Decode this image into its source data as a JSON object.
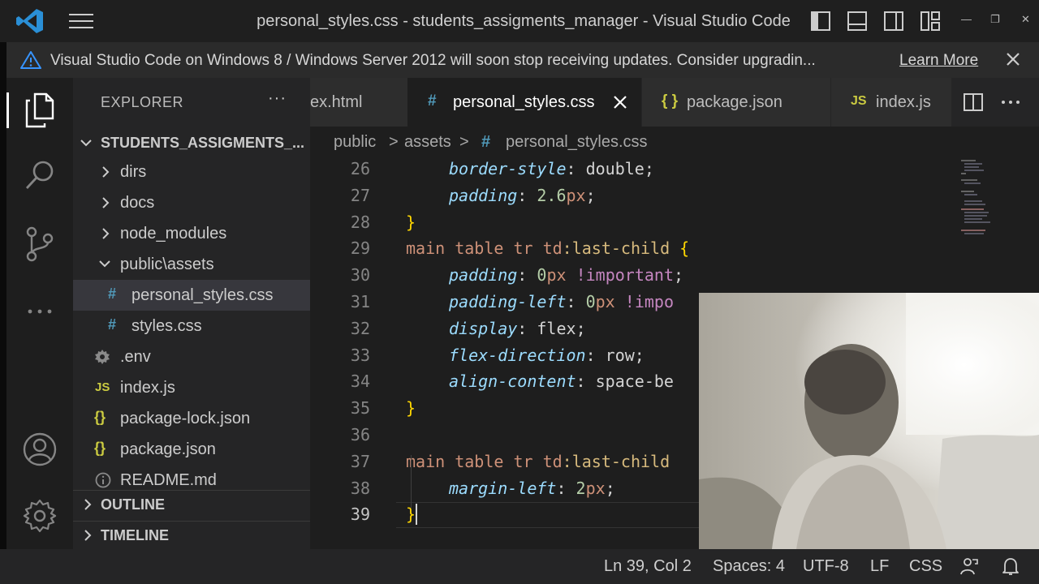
{
  "window": {
    "title": "personal_styles.css - students_assigments_manager - Visual Studio Code",
    "controls": [
      "—",
      "❐",
      "✕"
    ]
  },
  "banner": {
    "message": "Visual Studio Code on Windows 8 / Windows Server 2012 will soon stop receiving updates. Consider upgradin...",
    "learn_more": "Learn More"
  },
  "activity_bar": {
    "items": [
      "files-icon",
      "search-icon",
      "source-control-icon",
      "more-icon"
    ],
    "bottom": [
      "account-icon",
      "settings-icon"
    ]
  },
  "explorer": {
    "header": "EXPLORER",
    "more": "···",
    "project": "STUDENTS_ASSIGMENTS_...",
    "tree": [
      {
        "label": "dirs",
        "type": "folder"
      },
      {
        "label": "docs",
        "type": "folder"
      },
      {
        "label": "node_modules",
        "type": "folder"
      },
      {
        "label": "public\\assets",
        "type": "folder-open"
      },
      {
        "label": "personal_styles.css",
        "type": "css",
        "icon": "#"
      },
      {
        "label": "styles.css",
        "type": "css",
        "icon": "#"
      },
      {
        "label": ".env",
        "type": "env"
      },
      {
        "label": "index.js",
        "type": "js",
        "icon": "JS"
      },
      {
        "label": "package-lock.json",
        "type": "json",
        "icon": "{}"
      },
      {
        "label": "package.json",
        "type": "json",
        "icon": "{}"
      },
      {
        "label": "README.md",
        "type": "info"
      }
    ],
    "sections": [
      "OUTLINE",
      "TIMELINE"
    ]
  },
  "tabs": [
    {
      "label": "ex.html",
      "icon": ""
    },
    {
      "label": "personal_styles.css",
      "icon": "#"
    },
    {
      "label": "package.json",
      "icon": "{ }"
    },
    {
      "label": "index.js",
      "icon": "JS"
    }
  ],
  "breadcrumb": {
    "parts": [
      "public",
      "assets",
      "personal_styles.css"
    ],
    "sep": ">",
    "file_icon": "#"
  },
  "editor": {
    "lines": [
      {
        "n": "26",
        "prop": "border-style",
        "val": "double",
        "sep": ": ",
        "end": ";"
      },
      {
        "n": "27",
        "prop": "padding",
        "num": "2.6",
        "unit": "px",
        "sep": ": ",
        "end": ";"
      },
      {
        "n": "28",
        "brace": "}"
      },
      {
        "n": "29",
        "selector": "main table tr td",
        "pseudo": ":last-child",
        "open": " {"
      },
      {
        "n": "30",
        "prop": "padding",
        "num": "0",
        "unit": "px",
        "imp": " !important",
        "sep": ": ",
        "end": ";"
      },
      {
        "n": "31",
        "prop": "padding-left",
        "num": "0",
        "unit": "px",
        "imp": " !impo",
        "sep": ": ",
        "end": ""
      },
      {
        "n": "32",
        "prop": "display",
        "val": "flex",
        "sep": ": ",
        "end": ";"
      },
      {
        "n": "33",
        "prop": "flex-direction",
        "val": "row",
        "sep": ": ",
        "end": ";"
      },
      {
        "n": "34",
        "prop": "align-content",
        "val": "space-be",
        "sep": ": ",
        "end": ""
      },
      {
        "n": "35",
        "brace": "}"
      },
      {
        "n": "36"
      },
      {
        "n": "37",
        "selector": "main table tr td",
        "pseudo": ":last-child",
        "open": ""
      },
      {
        "n": "38",
        "prop": "margin-left",
        "num": "2",
        "unit": "px",
        "sep": ": ",
        "end": ";"
      },
      {
        "n": "39",
        "brace": "}"
      }
    ],
    "current_line": "39"
  },
  "status": {
    "position": "Ln 39, Col 2",
    "spaces": "Spaces: 4",
    "encoding": "UTF-8",
    "eol": "LF",
    "language": "CSS"
  },
  "colors": {
    "property": "#9cdcfe",
    "selector": "#d7ba7d",
    "tag": "#ce9178",
    "number": "#b5cea8",
    "unit": "#ce9178",
    "brace": "#ffd700",
    "css_icon": "#519aba",
    "json_icon": "#cbcb41",
    "js_icon": "#cbcb41"
  }
}
